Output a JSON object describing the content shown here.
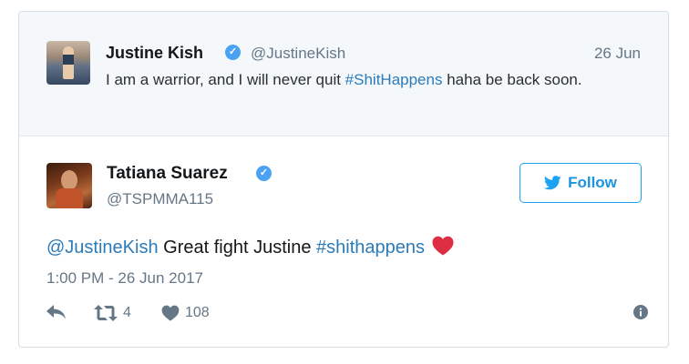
{
  "quoted": {
    "name": "Justine Kish",
    "handle": "@JustineKish",
    "date": "26 Jun",
    "text_before": "I am a warrior, and I will never quit ",
    "hashtag": "#ShitHappens",
    "text_after": " haha be back soon."
  },
  "tweet": {
    "name": "Tatiana Suarez",
    "handle": "@TSPMMA115",
    "follow_label": "Follow",
    "mention": "@JustineKish",
    "text_mid": " Great fight Justine ",
    "hashtag": "#shithappens",
    "timestamp": "1:00 PM - 26 Jun 2017",
    "retweets": "4",
    "likes": "108"
  },
  "colors": {
    "accent": "#1da1f2",
    "link": "#2b7bb9",
    "muted": "#657786",
    "verified": "#4ba2f2",
    "heart": "#e0245e"
  },
  "icons": [
    "verified-badge-icon",
    "twitter-bird-icon",
    "reply-icon",
    "retweet-icon",
    "heart-icon",
    "info-icon",
    "red-heart-emoji"
  ]
}
